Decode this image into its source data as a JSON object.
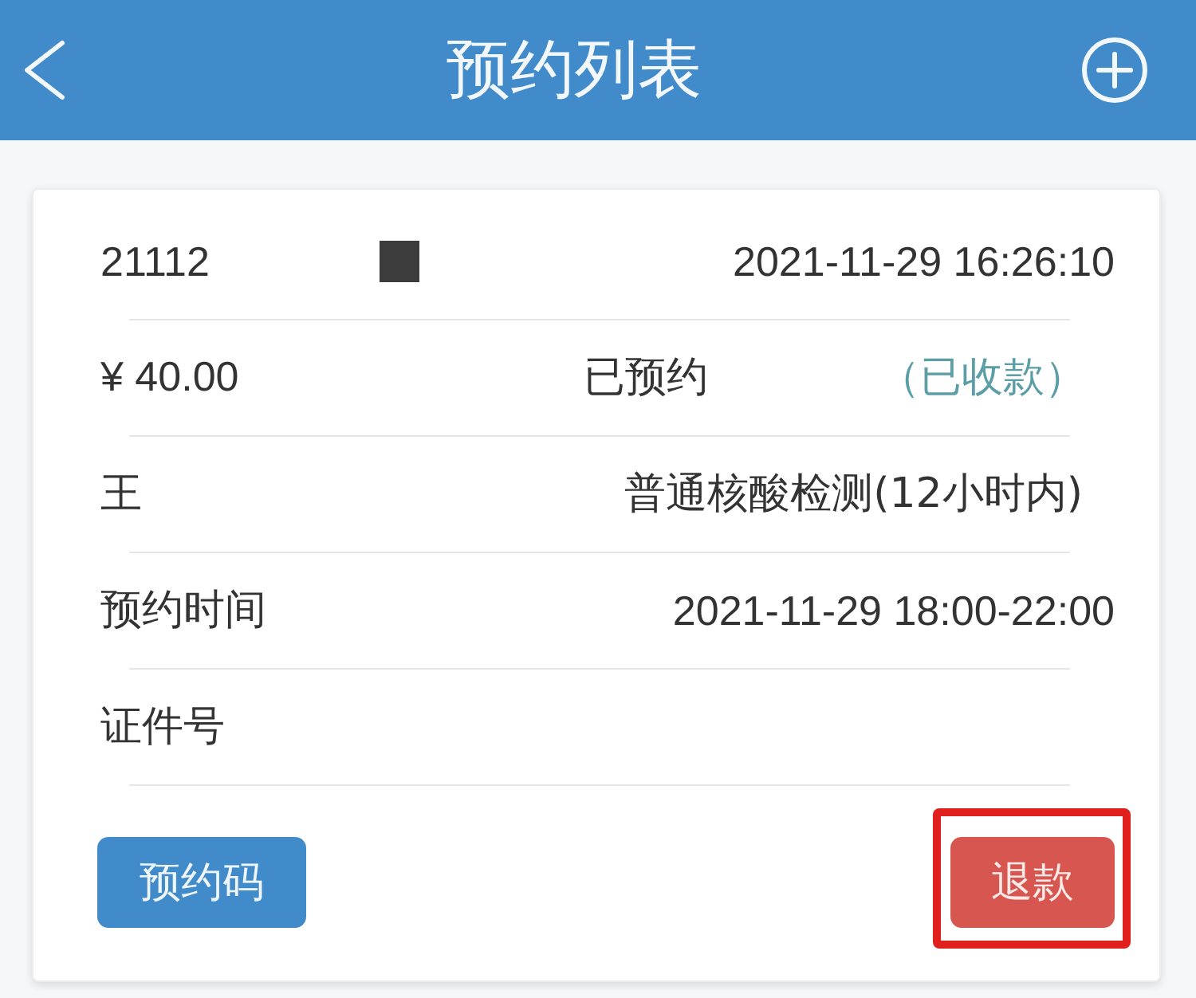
{
  "header": {
    "title": "预约列表"
  },
  "rows": [
    {
      "kind": "order",
      "order_no": "21112",
      "redacted": true,
      "created": "2021-11-29 16:26:10"
    },
    {
      "kind": "status",
      "price": "¥ 40.00",
      "status": "已预约",
      "payment": "（已收款）"
    },
    {
      "kind": "person",
      "name": "王",
      "service": "普通核酸检测(12小时内)"
    },
    {
      "kind": "field",
      "label": "预约时间",
      "value": "2021-11-29 18:00-22:00"
    },
    {
      "kind": "field",
      "label": "证件号"
    }
  ],
  "buttons": [
    {
      "label": "预约码",
      "kind": "primary",
      "highlighted": false
    },
    {
      "label": "退款",
      "kind": "danger",
      "highlighted": true
    }
  ]
}
